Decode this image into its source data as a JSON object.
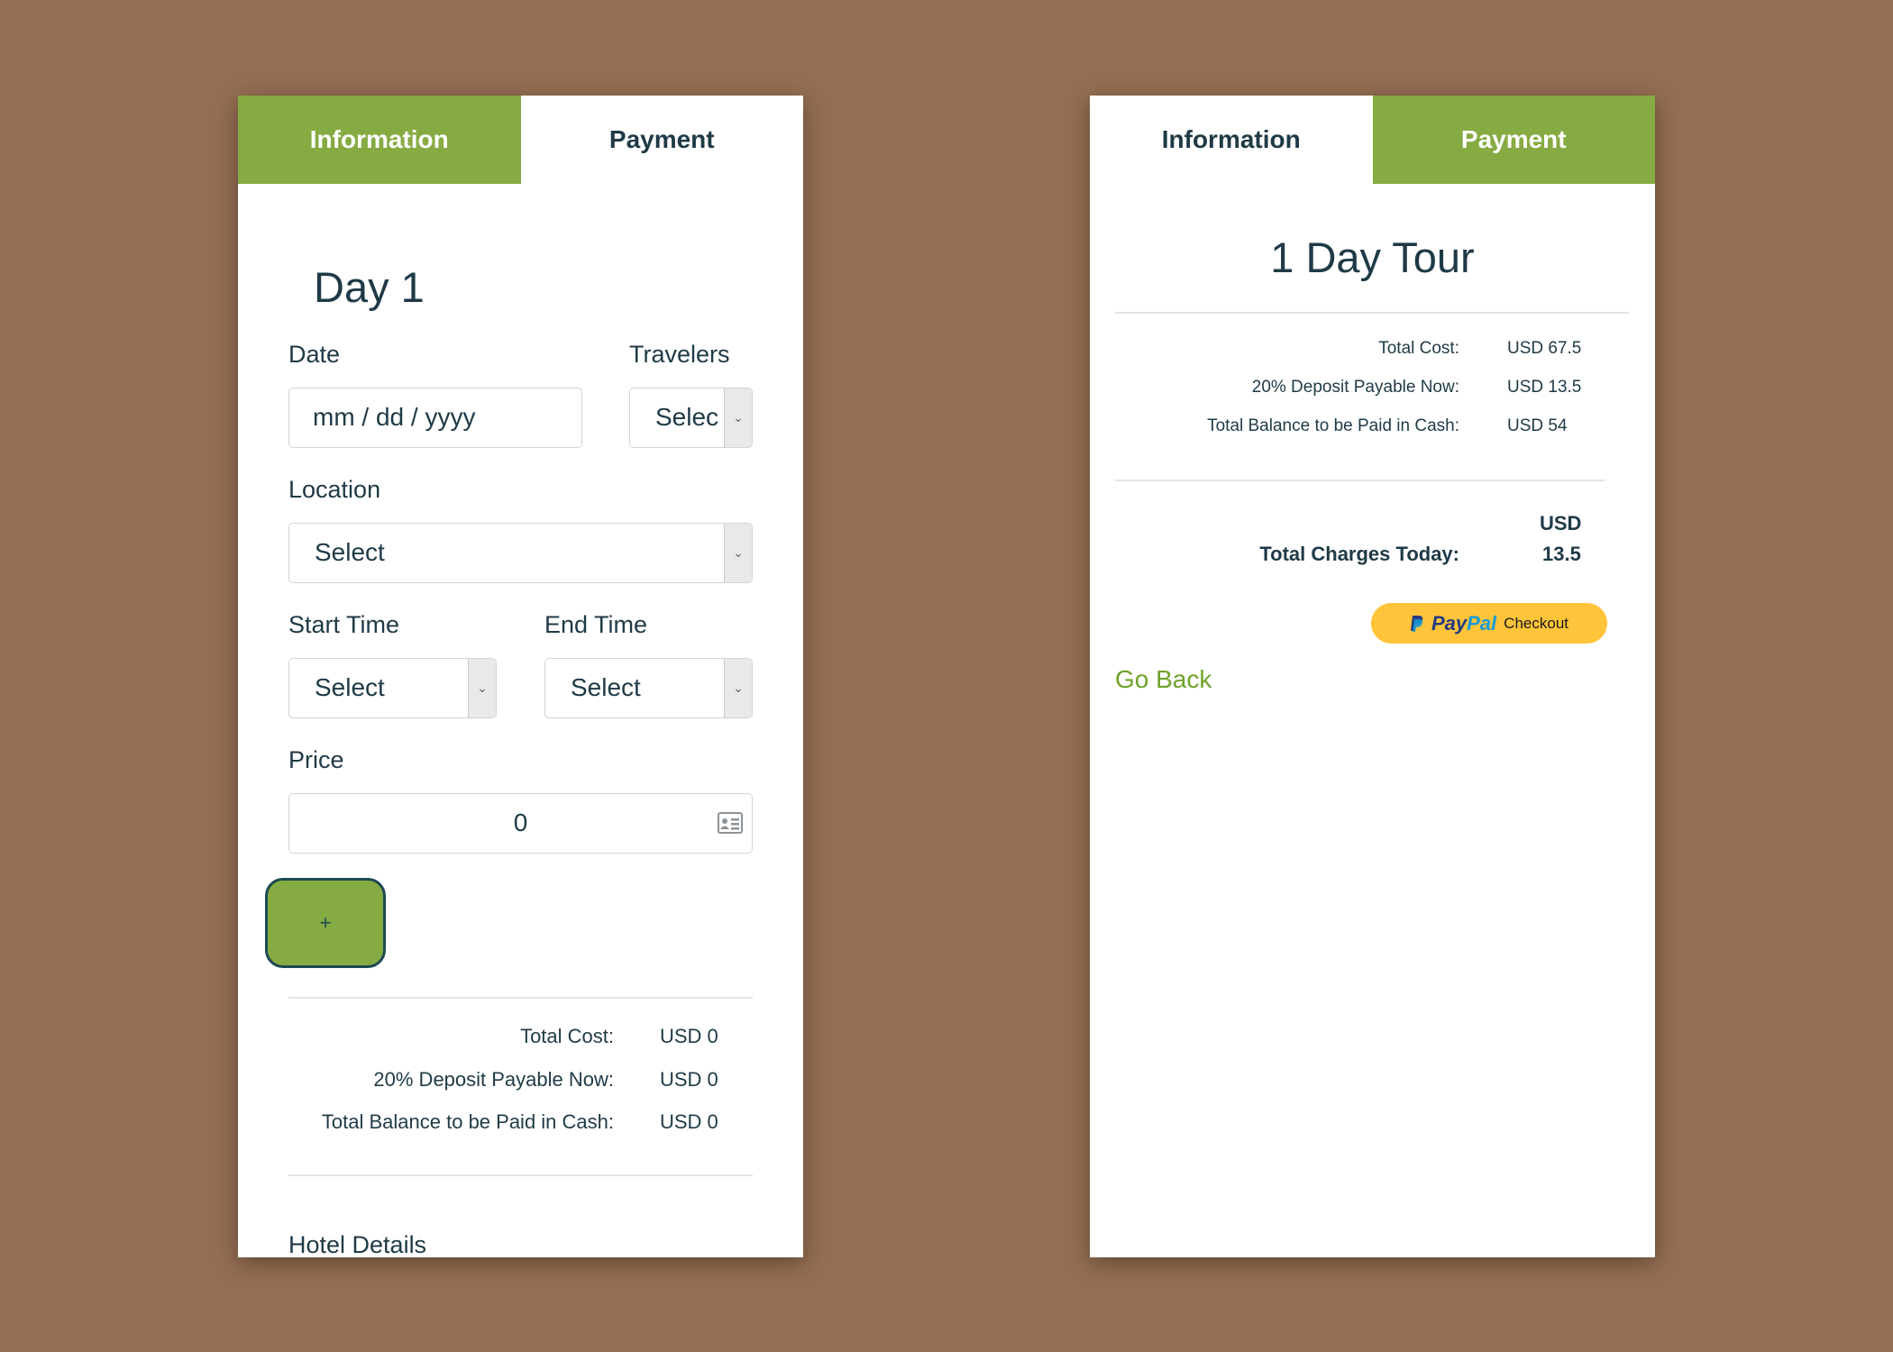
{
  "left": {
    "tabs": {
      "info": "Information",
      "payment": "Payment"
    },
    "day_title": "Day 1",
    "date": {
      "label": "Date",
      "placeholder": "mm / dd / yyyy"
    },
    "travelers": {
      "label": "Travelers",
      "value": "Selec"
    },
    "location": {
      "label": "Location",
      "value": "Select"
    },
    "start_time": {
      "label": "Start Time",
      "value": "Select"
    },
    "end_time": {
      "label": "End Time",
      "value": "Select"
    },
    "price": {
      "label": "Price",
      "value": "0"
    },
    "add_label": "+",
    "summary": [
      {
        "label": "Total Cost:",
        "value": "USD 0"
      },
      {
        "label": "20% Deposit Payable Now:",
        "value": "USD 0"
      },
      {
        "label": "Total Balance to be Paid in Cash:",
        "value": "USD 0"
      }
    ],
    "hotel_details": "Hotel Details"
  },
  "right": {
    "tabs": {
      "info": "Information",
      "payment": "Payment"
    },
    "tour_title": "1 Day Tour",
    "summary": [
      {
        "label": "Total Cost:",
        "value": "USD 67.5"
      },
      {
        "label": "20% Deposit Payable Now:",
        "value": "USD 13.5"
      },
      {
        "label": "Total Balance to be Paid in Cash:",
        "value": "USD 54"
      }
    ],
    "total_today": {
      "label": "Total Charges Today:",
      "currency": "USD",
      "amount": "13.5"
    },
    "paypal": {
      "brand_part1": "Pay",
      "brand_part2": "Pal",
      "label": "Checkout"
    },
    "go_back": "Go Back"
  },
  "colors": {
    "accent": "#86ab43",
    "text": "#1f3a46",
    "link": "#6fa22b",
    "paypal": "#ffc439",
    "background": "#936e53"
  },
  "icons": {
    "price_field_icon": "contact-card-icon",
    "dropdown_caret": "chevron-down-icon"
  }
}
